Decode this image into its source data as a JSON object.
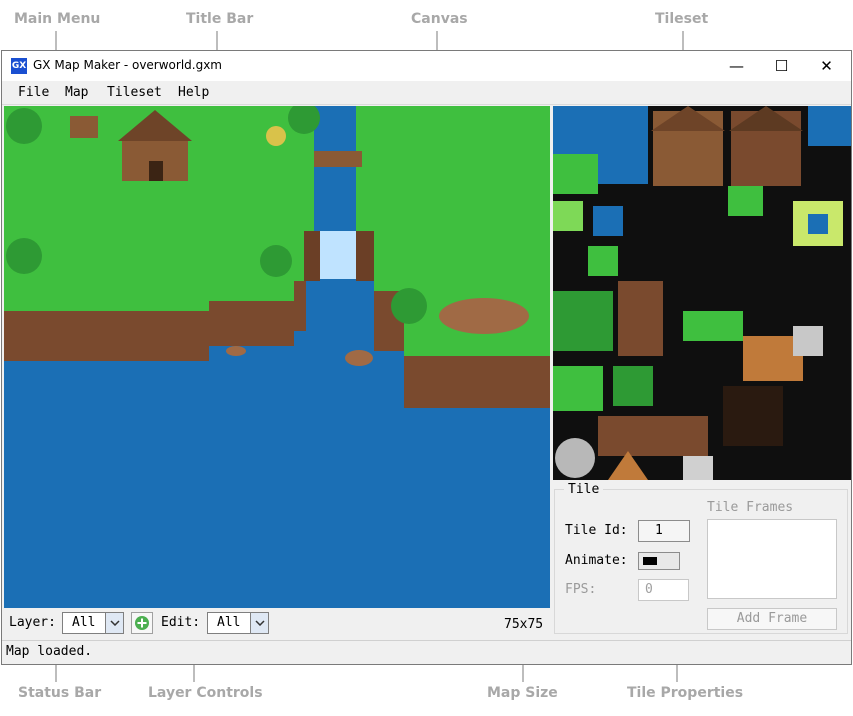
{
  "annotations": {
    "main_menu": "Main Menu",
    "title_bar": "Title Bar",
    "canvas": "Canvas",
    "tileset": "Tileset",
    "status_bar": "Status Bar",
    "layer_controls": "Layer Controls",
    "map_size": "Map Size",
    "tile_properties": "Tile Properties"
  },
  "window": {
    "title": "GX Map Maker - overworld.gxm",
    "icon_text": "GX",
    "controls": {
      "minimize": "—",
      "maximize": "☐",
      "close": "✕"
    }
  },
  "menu": {
    "items": [
      "File",
      "Map",
      "Tileset",
      "Help"
    ]
  },
  "tile_panel": {
    "group_title": "Tile",
    "tile_id_label": "Tile Id:",
    "tile_id_value": "1",
    "animate_label": "Animate:",
    "fps_label": "FPS:",
    "fps_value": "0",
    "frames_label": "Tile Frames",
    "add_frame_label": "Add Frame"
  },
  "layer_controls": {
    "layer_label": "Layer:",
    "layer_value": "All",
    "edit_label": "Edit:",
    "edit_value": "All",
    "add_icon": "add-layer-icon"
  },
  "map_size": "75x75",
  "status": "Map loaded.",
  "colors": {
    "grass": "#3fbf3f",
    "water": "#1b6fb5",
    "cliff": "#7a4a2e",
    "callout": "#a8a8a8"
  }
}
